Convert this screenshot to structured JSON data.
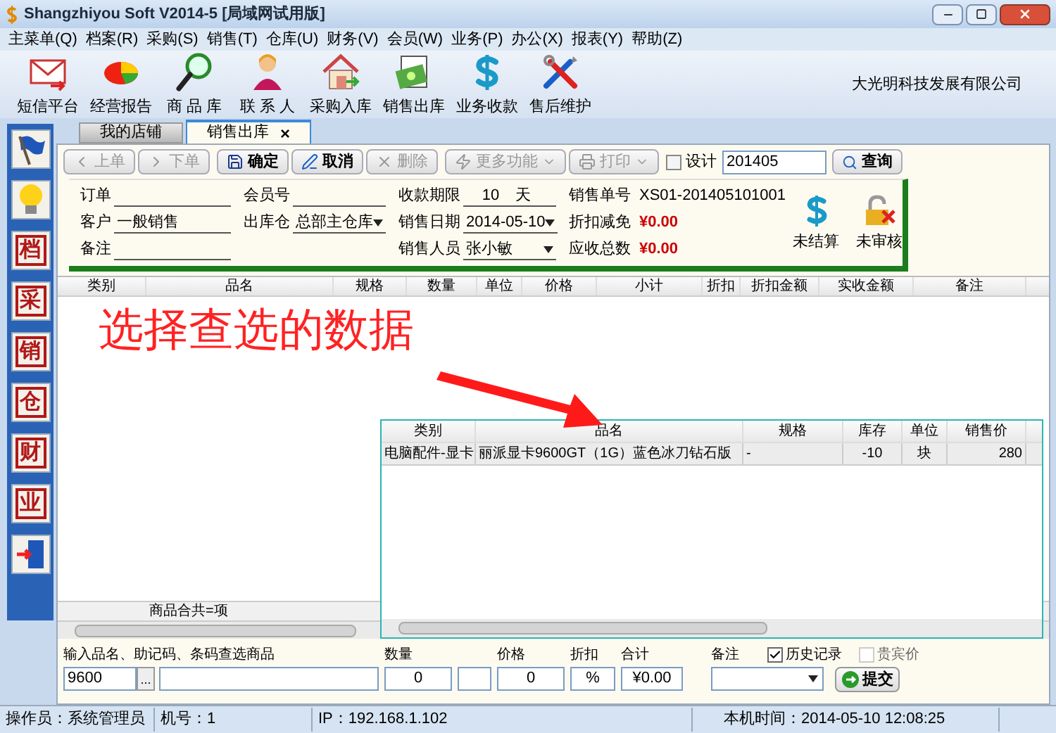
{
  "window": {
    "title": "Shangzhiyou Soft V2014-5 [局域网试用版]"
  },
  "menu": [
    "主菜单(Q)",
    "档案(R)",
    "采购(S)",
    "销售(T)",
    "仓库(U)",
    "财务(V)",
    "会员(W)",
    "业务(P)",
    "办公(X)",
    "报表(Y)",
    "帮助(Z)"
  ],
  "toolbar": [
    {
      "kind": "mail",
      "label": "短信平台"
    },
    {
      "kind": "pie",
      "label": "经营报告"
    },
    {
      "kind": "search",
      "label": "商 品 库"
    },
    {
      "kind": "person",
      "label": "联 系 人"
    },
    {
      "kind": "house",
      "label": "采购入库"
    },
    {
      "kind": "money",
      "label": "销售出库"
    },
    {
      "kind": "dollar",
      "label": "业务收款"
    },
    {
      "kind": "tools",
      "label": "售后维护"
    }
  ],
  "company": "大光明科技发展有限公司",
  "sidebar": [
    {
      "kind": "flag"
    },
    {
      "kind": "bulb"
    },
    {
      "kind": "stamp",
      "label": "档"
    },
    {
      "kind": "stamp",
      "label": "采"
    },
    {
      "kind": "stamp",
      "label": "销"
    },
    {
      "kind": "stamp",
      "label": "仓"
    },
    {
      "kind": "stamp",
      "label": "财"
    },
    {
      "kind": "stamp",
      "label": "业"
    },
    {
      "kind": "exit"
    }
  ],
  "tabs": [
    {
      "label": "我的店铺",
      "selected": false
    },
    {
      "label": "销售出库",
      "selected": true,
      "close": "×"
    }
  ],
  "buttons": [
    {
      "kind": "prev",
      "label": "上单",
      "disabled": true,
      "dropdown": false
    },
    {
      "kind": "next",
      "label": "下单",
      "disabled": true,
      "dropdown": false
    },
    {
      "kind": "save",
      "label": "确定",
      "disabled": false,
      "dropdown": false
    },
    {
      "kind": "cancel",
      "label": "取消",
      "disabled": false,
      "dropdown": false
    },
    {
      "kind": "delete",
      "label": "删除",
      "disabled": true,
      "dropdown": false
    },
    {
      "kind": "more",
      "label": "更多功能",
      "disabled": true,
      "dropdown": true
    },
    {
      "kind": "print",
      "label": "打印",
      "disabled": true,
      "dropdown": true
    }
  ],
  "design": {
    "label": "设计",
    "checked": false
  },
  "query": {
    "value": "201405",
    "button": "查询"
  },
  "form": {
    "columns": [
      [
        {
          "label": "订单",
          "kind": "line"
        },
        {
          "label": "客户",
          "value": "一般销售",
          "kind": "line"
        },
        {
          "label": "备注",
          "kind": "line"
        }
      ],
      [
        {
          "label": "会员号",
          "kind": "line"
        },
        {
          "label": "出库仓",
          "value": "总部主仓库",
          "kind": "select"
        }
      ],
      [
        {
          "label": "收款期限",
          "value": "10",
          "suffix": "天",
          "kind": "line"
        },
        {
          "label": "销售日期",
          "value": "2014-05-10",
          "kind": "select"
        },
        {
          "label": "销售人员",
          "value": "张小敏",
          "kind": "select"
        }
      ],
      [
        {
          "label": "销售单号",
          "value": "XS01-201405101001",
          "kind": "text"
        },
        {
          "label": "折扣减免",
          "value": "¥0.00",
          "kind": "money"
        },
        {
          "label": "应收总数",
          "value": "¥0.00",
          "kind": "money"
        }
      ]
    ],
    "status": [
      {
        "kind": "dollar",
        "label": "未结算"
      },
      {
        "kind": "lock",
        "label": "未审核"
      }
    ]
  },
  "table": {
    "columns": [
      "类别",
      "品名",
      "规格",
      "数量",
      "单位",
      "价格",
      "小计",
      "折扣",
      "折扣金额",
      "实收金额",
      "备注"
    ],
    "footer": "商品合共=项"
  },
  "annotation": {
    "text": "选择查选的数据"
  },
  "popup": {
    "columns": [
      "类别",
      "品名",
      "规格",
      "库存",
      "单位",
      "销售价"
    ],
    "rows": [
      {
        "cells": [
          "电脑配件-显卡",
          "丽派显卡9600GT（1G）蓝色冰刀钻石版",
          "-",
          "-10",
          "块",
          "280"
        ],
        "selected": true
      }
    ]
  },
  "entry": {
    "search_label": "输入品名、助记码、条码查选商品",
    "code": "9600",
    "browse": "...",
    "fields": [
      {
        "kind": "qty",
        "label": "数量",
        "value": "0"
      },
      {
        "kind": "blank"
      },
      {
        "kind": "price",
        "label": "价格",
        "value": "0"
      },
      {
        "kind": "discount",
        "label": "折扣",
        "value": "%"
      },
      {
        "kind": "total",
        "label": "合计",
        "value": "¥0.00"
      }
    ],
    "note_label": "备注",
    "options": [
      {
        "label": "历史记录",
        "checked": true,
        "disabled": false
      },
      {
        "label": "贵宾价",
        "checked": false,
        "disabled": true
      }
    ],
    "submit": "提交"
  },
  "status_bar": [
    "操作员：系统管理员",
    "机号：1",
    "IP：192.168.1.102",
    "本机时间：2014-05-10 12:08:25"
  ]
}
